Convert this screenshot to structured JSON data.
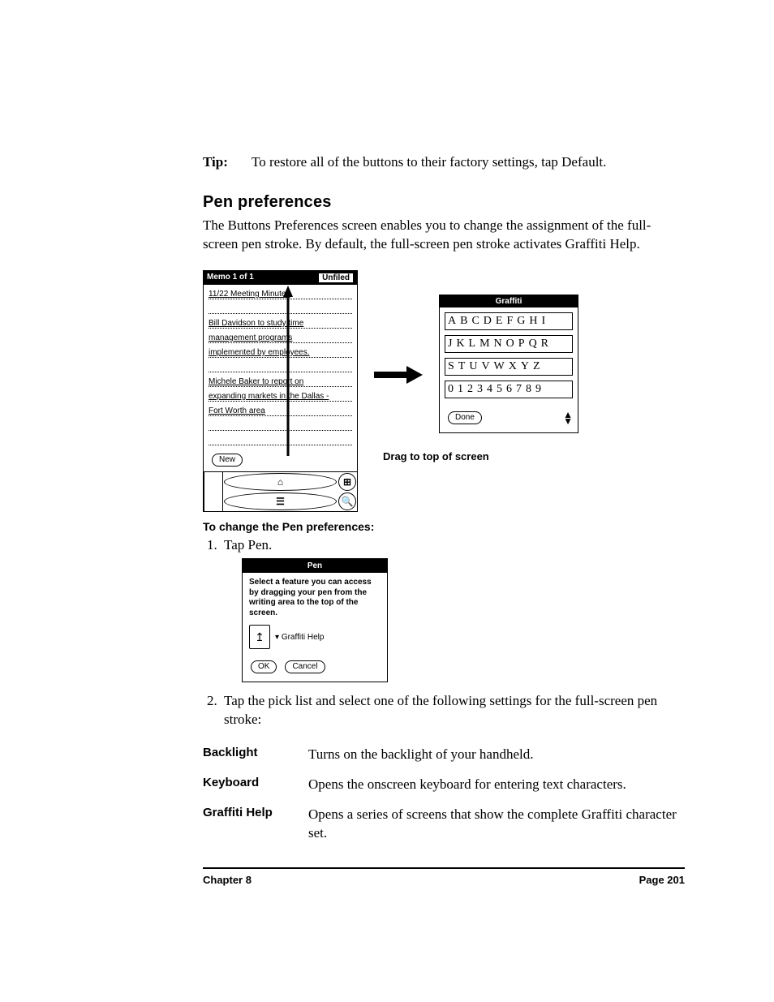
{
  "tip": {
    "label": "Tip:",
    "text": "To restore all of the buttons to their factory settings, tap Default."
  },
  "section_heading": "Pen preferences",
  "intro_para": "The Buttons Preferences screen enables you to change the assignment of the full-screen pen stroke. By default, the full-screen pen stroke activates Graffiti Help.",
  "memo": {
    "title": "Memo 1 of 1",
    "category": "Unfiled",
    "line1": "11/22 Meeting Minutes",
    "para1_l1": "Bill Davidson to study time",
    "para1_l2": "management programs",
    "para1_l3": "implemented by employees.",
    "para2_l1": "Michele Baker to report on",
    "para2_l2": "expanding markets in the Dallas -",
    "para2_l3": "Fort Worth area",
    "new_btn": "New"
  },
  "graffiti": {
    "title": "Graffiti",
    "row1": "ABCDEFGHI",
    "row2": "JKLMNOPQR",
    "row3": "STUVWXYZ",
    "row4": "0123456789",
    "done_btn": "Done"
  },
  "drag_caption": "Drag to top of screen",
  "subhead1": "To change the Pen preferences:",
  "step1": "Tap Pen.",
  "pen_dialog": {
    "title": "Pen",
    "body": "Select a feature you can access by dragging your pen from the writing area to the top of the screen.",
    "picklist": "Graffiti Help",
    "ok": "OK",
    "cancel": "Cancel"
  },
  "step2": "Tap the pick list and select one of the following settings for the full-screen pen stroke:",
  "defs": [
    {
      "term": "Backlight",
      "desc": "Turns on the backlight of your handheld."
    },
    {
      "term": "Keyboard",
      "desc": "Opens the onscreen keyboard for entering text characters."
    },
    {
      "term": "Graffiti Help",
      "desc": "Opens a series of screens that show the complete Graffiti character set."
    }
  ],
  "footer": {
    "left": "Chapter 8",
    "right": "Page 201"
  }
}
